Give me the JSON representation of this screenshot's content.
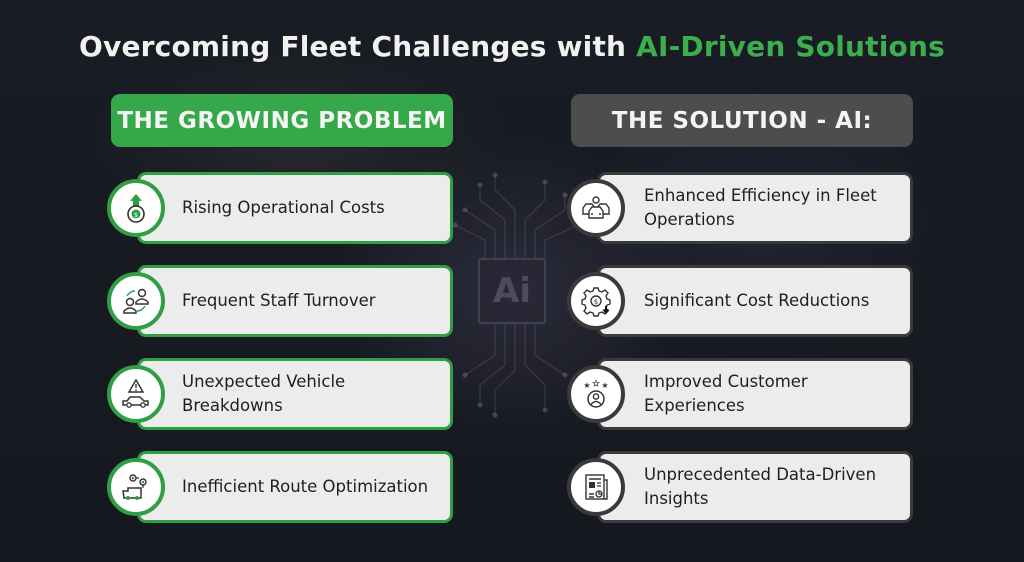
{
  "title": {
    "prefix": "Overcoming Fleet Challenges with ",
    "highlight": "AI-Driven Solutions"
  },
  "background": {
    "chip_text": "Ai"
  },
  "problem": {
    "header": "THE GROWING PROBLEM",
    "items": [
      {
        "label": "Rising Operational Costs",
        "icon": "rising-cost-icon"
      },
      {
        "label": "Frequent Staff Turnover",
        "icon": "staff-turnover-icon"
      },
      {
        "label": "Unexpected Vehicle Breakdowns",
        "icon": "vehicle-breakdown-icon"
      },
      {
        "label": "Inefficient Route Optimization",
        "icon": "route-optimization-icon"
      }
    ]
  },
  "solution": {
    "header": "THE SOLUTION - AI:",
    "items": [
      {
        "label": "Enhanced Efficiency in Fleet Operations",
        "icon": "fleet-efficiency-icon"
      },
      {
        "label": "Significant Cost Reductions",
        "icon": "cost-reduction-icon"
      },
      {
        "label": "Improved Customer Experiences",
        "icon": "customer-experience-icon"
      },
      {
        "label": "Unprecedented Data-Driven Insights",
        "icon": "data-insights-icon"
      }
    ]
  },
  "colors": {
    "accent_green": "#35a94a",
    "title_green": "#3cae4e",
    "solution_gray": "#4d4d4f",
    "background": "#171a22",
    "card_bg": "#ececec"
  }
}
